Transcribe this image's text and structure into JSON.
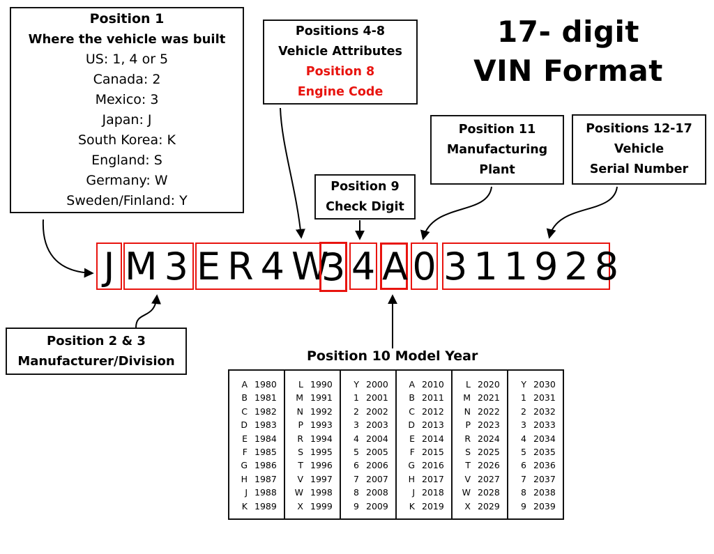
{
  "title": {
    "line1": "17- digit",
    "line2": "VIN Format"
  },
  "vin": {
    "groups": [
      {
        "chars": "J",
        "position": "1"
      },
      {
        "chars": "M3",
        "position": "2-3"
      },
      {
        "chars": "ER4W",
        "position": "4-7"
      },
      {
        "chars": "3",
        "position": "8",
        "highlight": true
      },
      {
        "chars": "4",
        "position": "9"
      },
      {
        "chars": "A",
        "position": "10",
        "highlight": true
      },
      {
        "chars": "0",
        "position": "11"
      },
      {
        "chars": "311928",
        "position": "12-17"
      }
    ],
    "border_color": "#e8140f"
  },
  "boxes": {
    "position1": {
      "heading": "Position 1",
      "subheading": "Where the vehicle was built",
      "items": [
        "US: 1, 4 or 5",
        "Canada: 2",
        "Mexico: 3",
        "Japan: J",
        "South Korea: K",
        "England: S",
        "Germany: W",
        "Sweden/Finland: Y"
      ]
    },
    "positions4to8": {
      "line1": "Positions 4-8",
      "line2": "Vehicle Attributes",
      "red_line1": "Position 8",
      "red_line2": "Engine Code"
    },
    "position9": {
      "line1": "Position 9",
      "line2": "Check Digit"
    },
    "position11": {
      "line1": "Position 11",
      "line2": "Manufacturing",
      "line3": "Plant"
    },
    "positions12to17": {
      "line1": "Positions 12-17",
      "line2": "Vehicle",
      "line3": "Serial Number"
    },
    "position2and3": {
      "line1": "Position 2 & 3",
      "line2": "Manufacturer/Division"
    }
  },
  "model_year": {
    "title": "Position 10 Model Year",
    "columns": [
      [
        [
          "A",
          "1980"
        ],
        [
          "B",
          "1981"
        ],
        [
          "C",
          "1982"
        ],
        [
          "D",
          "1983"
        ],
        [
          "E",
          "1984"
        ],
        [
          "F",
          "1985"
        ],
        [
          "G",
          "1986"
        ],
        [
          "H",
          "1987"
        ],
        [
          "J",
          "1988"
        ],
        [
          "K",
          "1989"
        ]
      ],
      [
        [
          "L",
          "1990"
        ],
        [
          "M",
          "1991"
        ],
        [
          "N",
          "1992"
        ],
        [
          "P",
          "1993"
        ],
        [
          "R",
          "1994"
        ],
        [
          "S",
          "1995"
        ],
        [
          "T",
          "1996"
        ],
        [
          "V",
          "1997"
        ],
        [
          "W",
          "1998"
        ],
        [
          "X",
          "1999"
        ]
      ],
      [
        [
          "Y",
          "2000"
        ],
        [
          "1",
          "2001"
        ],
        [
          "2",
          "2002"
        ],
        [
          "3",
          "2003"
        ],
        [
          "4",
          "2004"
        ],
        [
          "5",
          "2005"
        ],
        [
          "6",
          "2006"
        ],
        [
          "7",
          "2007"
        ],
        [
          "8",
          "2008"
        ],
        [
          "9",
          "2009"
        ]
      ],
      [
        [
          "A",
          "2010"
        ],
        [
          "B",
          "2011"
        ],
        [
          "C",
          "2012"
        ],
        [
          "D",
          "2013"
        ],
        [
          "E",
          "2014"
        ],
        [
          "F",
          "2015"
        ],
        [
          "G",
          "2016"
        ],
        [
          "H",
          "2017"
        ],
        [
          "J",
          "2018"
        ],
        [
          "K",
          "2019"
        ]
      ],
      [
        [
          "L",
          "2020"
        ],
        [
          "M",
          "2021"
        ],
        [
          "N",
          "2022"
        ],
        [
          "P",
          "2023"
        ],
        [
          "R",
          "2024"
        ],
        [
          "S",
          "2025"
        ],
        [
          "T",
          "2026"
        ],
        [
          "V",
          "2027"
        ],
        [
          "W",
          "2028"
        ],
        [
          "X",
          "2029"
        ]
      ],
      [
        [
          "Y",
          "2030"
        ],
        [
          "1",
          "2031"
        ],
        [
          "2",
          "2032"
        ],
        [
          "3",
          "2033"
        ],
        [
          "4",
          "2034"
        ],
        [
          "5",
          "2035"
        ],
        [
          "6",
          "2036"
        ],
        [
          "7",
          "2037"
        ],
        [
          "8",
          "2038"
        ],
        [
          "9",
          "2039"
        ]
      ]
    ]
  }
}
